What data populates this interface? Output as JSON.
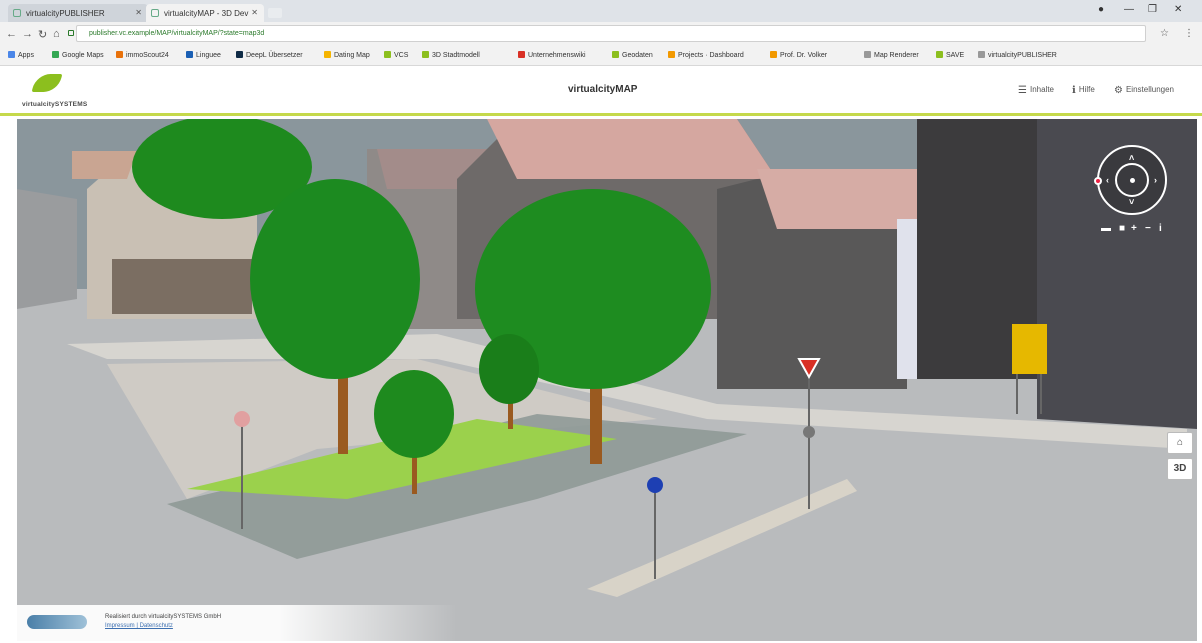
{
  "browser": {
    "tabs": [
      {
        "label": "virtualcityPUBLISHER"
      },
      {
        "label": "virtualcityMAP - 3D Dev"
      }
    ],
    "url": "publisher.vc.example/MAP/virtualcityMAP/?state=map3d",
    "bookmarks": [
      {
        "label": "Apps",
        "color": "#4a86e8"
      },
      {
        "label": "Google Maps",
        "color": "#34a853"
      },
      {
        "label": "immoScout24",
        "color": "#e8710a"
      },
      {
        "label": "Linguee",
        "color": "#1a5fb4"
      },
      {
        "label": "DeepL Übersetzer",
        "color": "#0f2b46"
      },
      {
        "label": "Dating Map",
        "color": "#f5b400"
      },
      {
        "label": "VCS",
        "color": "#8cbf1e"
      },
      {
        "label": "3D Stadtmodell",
        "color": "#8cbf1e"
      },
      {
        "label": "Unternehmenswiki",
        "color": "#d93025"
      },
      {
        "label": "Geodaten",
        "color": "#8cbf1e"
      },
      {
        "label": "Projects · Dashboard",
        "color": "#f29900"
      },
      {
        "label": "Prof. Dr. Volker",
        "color": "#f29900"
      },
      {
        "label": "Map Renderer",
        "color": "#999999"
      },
      {
        "label": "SAVE",
        "color": "#8cbf1e"
      },
      {
        "label": "virtualcityPUBLISHER",
        "color": "#999999"
      }
    ]
  },
  "header": {
    "logo_text": "virtualcitySYSTEMS",
    "title": "virtualcityMAP",
    "menu": [
      {
        "label": "Inhalte",
        "icon": "list-icon"
      },
      {
        "label": "Hilfe",
        "icon": "info-icon"
      },
      {
        "label": "Einstellungen",
        "icon": "gear-icon"
      }
    ]
  },
  "viewport": {
    "view_mode": "3D",
    "controls": {
      "home_icon": "home-icon",
      "mode_label": "3D"
    }
  },
  "footer": {
    "line1": "Realisiert durch virtualcitySYSTEMS GmbH",
    "line2": "Impressum | Datenschutz"
  },
  "colors": {
    "accent": "#c5d94b",
    "brand_green": "#8cbf1e",
    "tree_green": "#1e8a1e"
  }
}
